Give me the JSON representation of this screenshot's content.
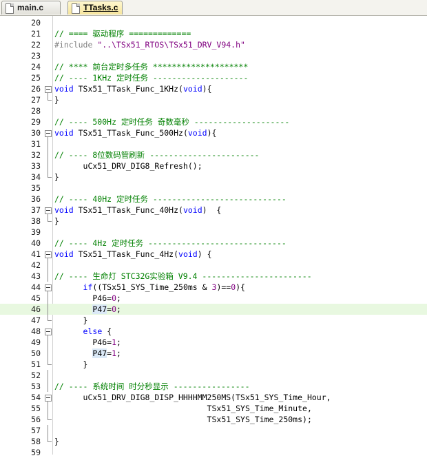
{
  "tabs": [
    {
      "label": "main.c",
      "active": false
    },
    {
      "label": "TTasks.c",
      "active": true
    }
  ],
  "current_line": 46,
  "lines": [
    {
      "n": "20",
      "tokens": []
    },
    {
      "n": "21",
      "tokens": [
        {
          "t": "// ==== 驱动程序 =============",
          "c": "cm"
        }
      ]
    },
    {
      "n": "22",
      "tokens": [
        {
          "t": "#include ",
          "c": "pp"
        },
        {
          "t": "\"..\\TSx51_RTOS\\TSx51_DRV_V94.h\"",
          "c": "st"
        }
      ]
    },
    {
      "n": "23",
      "tokens": []
    },
    {
      "n": "24",
      "tokens": [
        {
          "t": "// **** 前台定时多任务 ********************",
          "c": "cm"
        }
      ]
    },
    {
      "n": "25",
      "tokens": [
        {
          "t": "// ---- 1KHz 定时任务 --------------------",
          "c": "cm"
        }
      ]
    },
    {
      "n": "26",
      "fold": "start",
      "tokens": [
        {
          "t": "void",
          "c": "kw"
        },
        {
          "t": " TSx51_TTask_Func_1KHz(",
          "c": ""
        },
        {
          "t": "void",
          "c": "kw"
        },
        {
          "t": "){",
          "c": ""
        }
      ]
    },
    {
      "n": "27",
      "fold": "end",
      "tokens": [
        {
          "t": "}",
          "c": ""
        }
      ]
    },
    {
      "n": "28",
      "tokens": []
    },
    {
      "n": "29",
      "tokens": [
        {
          "t": "// ---- 500Hz 定时任务 奇数毫秒 --------------------",
          "c": "cm"
        }
      ]
    },
    {
      "n": "30",
      "fold": "start",
      "tokens": [
        {
          "t": "void",
          "c": "kw"
        },
        {
          "t": " TSx51_TTask_Func_500Hz(",
          "c": ""
        },
        {
          "t": "void",
          "c": "kw"
        },
        {
          "t": "){",
          "c": ""
        }
      ]
    },
    {
      "n": "31",
      "fold": "mid",
      "tokens": []
    },
    {
      "n": "32",
      "fold": "mid",
      "tokens": [
        {
          "t": "// ---- 8位数码管刷新 -----------------------",
          "c": "cm"
        }
      ]
    },
    {
      "n": "33",
      "fold": "mid",
      "tokens": [
        {
          "t": "      uCx51_DRV_DIG8_Refresh();",
          "c": ""
        }
      ]
    },
    {
      "n": "34",
      "fold": "end",
      "tokens": [
        {
          "t": "}",
          "c": ""
        }
      ]
    },
    {
      "n": "35",
      "tokens": []
    },
    {
      "n": "36",
      "tokens": [
        {
          "t": "// ---- 40Hz 定时任务 ----------------------------",
          "c": "cm"
        }
      ]
    },
    {
      "n": "37",
      "fold": "start",
      "tokens": [
        {
          "t": "void",
          "c": "kw"
        },
        {
          "t": " TSx51_TTask_Func_40Hz(",
          "c": ""
        },
        {
          "t": "void",
          "c": "kw"
        },
        {
          "t": ")  {",
          "c": ""
        }
      ]
    },
    {
      "n": "38",
      "fold": "end",
      "tokens": [
        {
          "t": "}",
          "c": ""
        }
      ]
    },
    {
      "n": "39",
      "tokens": []
    },
    {
      "n": "40",
      "tokens": [
        {
          "t": "// ---- 4Hz 定时任务 -----------------------------",
          "c": "cm"
        }
      ]
    },
    {
      "n": "41",
      "fold": "start",
      "tokens": [
        {
          "t": "void",
          "c": "kw"
        },
        {
          "t": " TSx51_TTask_Func_4Hz(",
          "c": ""
        },
        {
          "t": "void",
          "c": "kw"
        },
        {
          "t": ") {",
          "c": ""
        }
      ]
    },
    {
      "n": "42",
      "fold": "mid",
      "tokens": []
    },
    {
      "n": "43",
      "fold": "mid",
      "tokens": [
        {
          "t": "// ---- 生命灯 STC32G实验箱 V9.4 -----------------------",
          "c": "cm"
        }
      ]
    },
    {
      "n": "44",
      "fold": "start",
      "tokens": [
        {
          "t": "      ",
          "c": ""
        },
        {
          "t": "if",
          "c": "kw"
        },
        {
          "t": "((TSx51_SYS_Time_250ms & ",
          "c": ""
        },
        {
          "t": "3",
          "c": "nu"
        },
        {
          "t": ")==",
          "c": ""
        },
        {
          "t": "0",
          "c": "nu"
        },
        {
          "t": "){",
          "c": ""
        }
      ]
    },
    {
      "n": "45",
      "fold": "mid",
      "tokens": [
        {
          "t": "        P46=",
          "c": ""
        },
        {
          "t": "0",
          "c": "nu"
        },
        {
          "t": ";",
          "c": ""
        }
      ]
    },
    {
      "n": "46",
      "fold": "mid",
      "tokens": [
        {
          "t": "        ",
          "c": ""
        },
        {
          "t": "P47",
          "c": "hl"
        },
        {
          "t": "=",
          "c": ""
        },
        {
          "t": "0",
          "c": "nu"
        },
        {
          "t": ";",
          "c": ""
        }
      ]
    },
    {
      "n": "47",
      "fold": "end",
      "tokens": [
        {
          "t": "      }",
          "c": ""
        }
      ]
    },
    {
      "n": "48",
      "fold": "start",
      "tokens": [
        {
          "t": "      ",
          "c": ""
        },
        {
          "t": "else",
          "c": "kw"
        },
        {
          "t": " {",
          "c": ""
        }
      ]
    },
    {
      "n": "49",
      "fold": "mid",
      "tokens": [
        {
          "t": "        P46=",
          "c": ""
        },
        {
          "t": "1",
          "c": "nu"
        },
        {
          "t": ";",
          "c": ""
        }
      ]
    },
    {
      "n": "50",
      "fold": "mid",
      "tokens": [
        {
          "t": "        ",
          "c": ""
        },
        {
          "t": "P47",
          "c": "hl"
        },
        {
          "t": "=",
          "c": ""
        },
        {
          "t": "1",
          "c": "nu"
        },
        {
          "t": ";",
          "c": ""
        }
      ]
    },
    {
      "n": "51",
      "fold": "end",
      "tokens": [
        {
          "t": "      }",
          "c": ""
        }
      ]
    },
    {
      "n": "52",
      "fold": "mid",
      "tokens": []
    },
    {
      "n": "53",
      "fold": "mid",
      "tokens": [
        {
          "t": "// ---- 系统时间 时分秒显示 ----------------",
          "c": "cm"
        }
      ]
    },
    {
      "n": "54",
      "fold": "start",
      "tokens": [
        {
          "t": "      uCx51_DRV_DIG8_DISP_HHHHMM250MS(TSx51_SYS_Time_Hour,",
          "c": ""
        }
      ]
    },
    {
      "n": "55",
      "fold": "mid",
      "tokens": [
        {
          "t": "                                TSx51_SYS_Time_Minute,",
          "c": ""
        }
      ]
    },
    {
      "n": "56",
      "fold": "end",
      "tokens": [
        {
          "t": "                                TSx51_SYS_Time_250ms);",
          "c": ""
        }
      ]
    },
    {
      "n": "57",
      "fold": "mid",
      "tokens": []
    },
    {
      "n": "58",
      "fold": "end",
      "tokens": [
        {
          "t": "}",
          "c": ""
        }
      ]
    },
    {
      "n": "59",
      "tokens": []
    }
  ]
}
